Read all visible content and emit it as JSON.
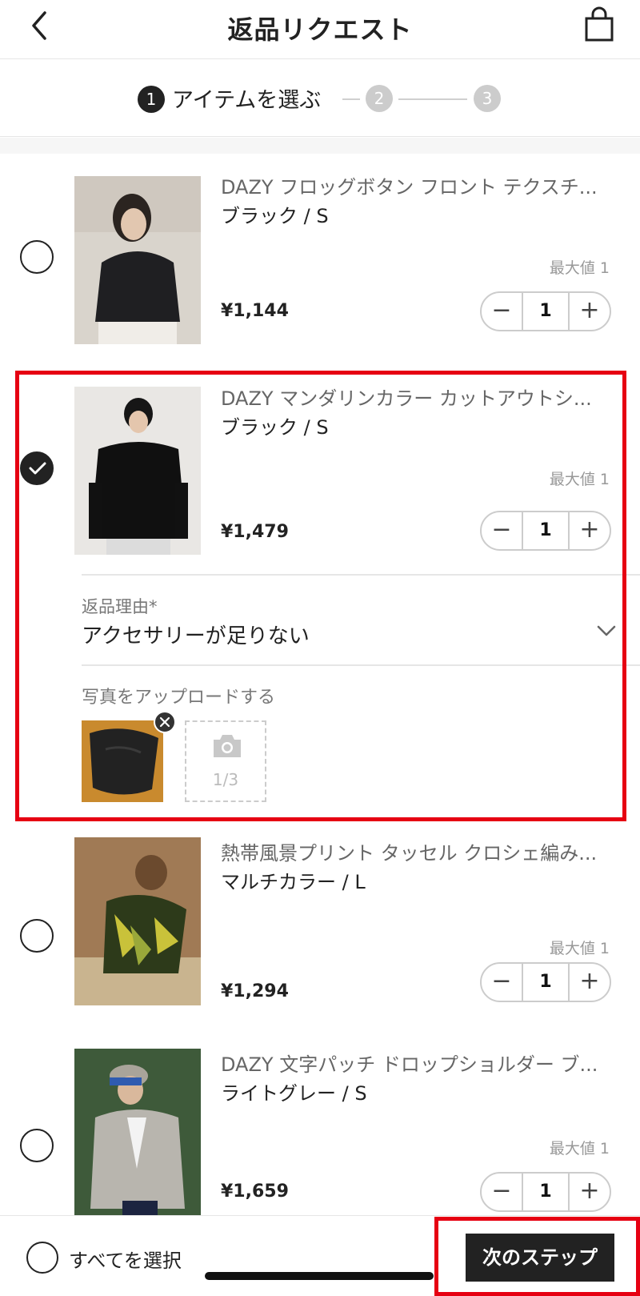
{
  "header": {
    "title": "返品リクエスト",
    "back_icon": "chevron-left-icon",
    "bag_icon": "shopping-bag-icon"
  },
  "stepper": {
    "steps": [
      {
        "number": "1",
        "label": "アイテムを選ぶ",
        "active": true
      },
      {
        "number": "2",
        "label": "",
        "active": false
      },
      {
        "number": "3",
        "label": "",
        "active": false
      }
    ]
  },
  "items": [
    {
      "name": "DAZY フロッグボタン フロント テクスチ...",
      "variant": "ブラック / S",
      "max_label": "最大値 1",
      "price": "¥1,144",
      "qty": "1",
      "selected": false
    },
    {
      "name": "DAZY マンダリンカラー カットアウトシ...",
      "variant": "ブラック / S",
      "max_label": "最大値 1",
      "price": "¥1,479",
      "qty": "1",
      "selected": true
    },
    {
      "name": "熱帯風景プリント タッセル クロシェ編み...",
      "variant": "マルチカラー / L",
      "max_label": "最大値 1",
      "price": "¥1,294",
      "qty": "1",
      "selected": false
    },
    {
      "name": "DAZY 文字パッチ ドロップショルダー ブ...",
      "variant": "ライトグレー / S",
      "max_label": "最大値 1",
      "price": "¥1,659",
      "qty": "1",
      "selected": false
    }
  ],
  "return_form": {
    "reason_label": "返品理由*",
    "reason_value": "アクセサリーが足りない",
    "upload_label": "写真をアップロードする",
    "upload_count": "1/3"
  },
  "bottom": {
    "select_all_label": "すべてを選択",
    "next_label": "次のステップ"
  },
  "colors": {
    "highlight": "#e60012",
    "primary": "#222222"
  }
}
